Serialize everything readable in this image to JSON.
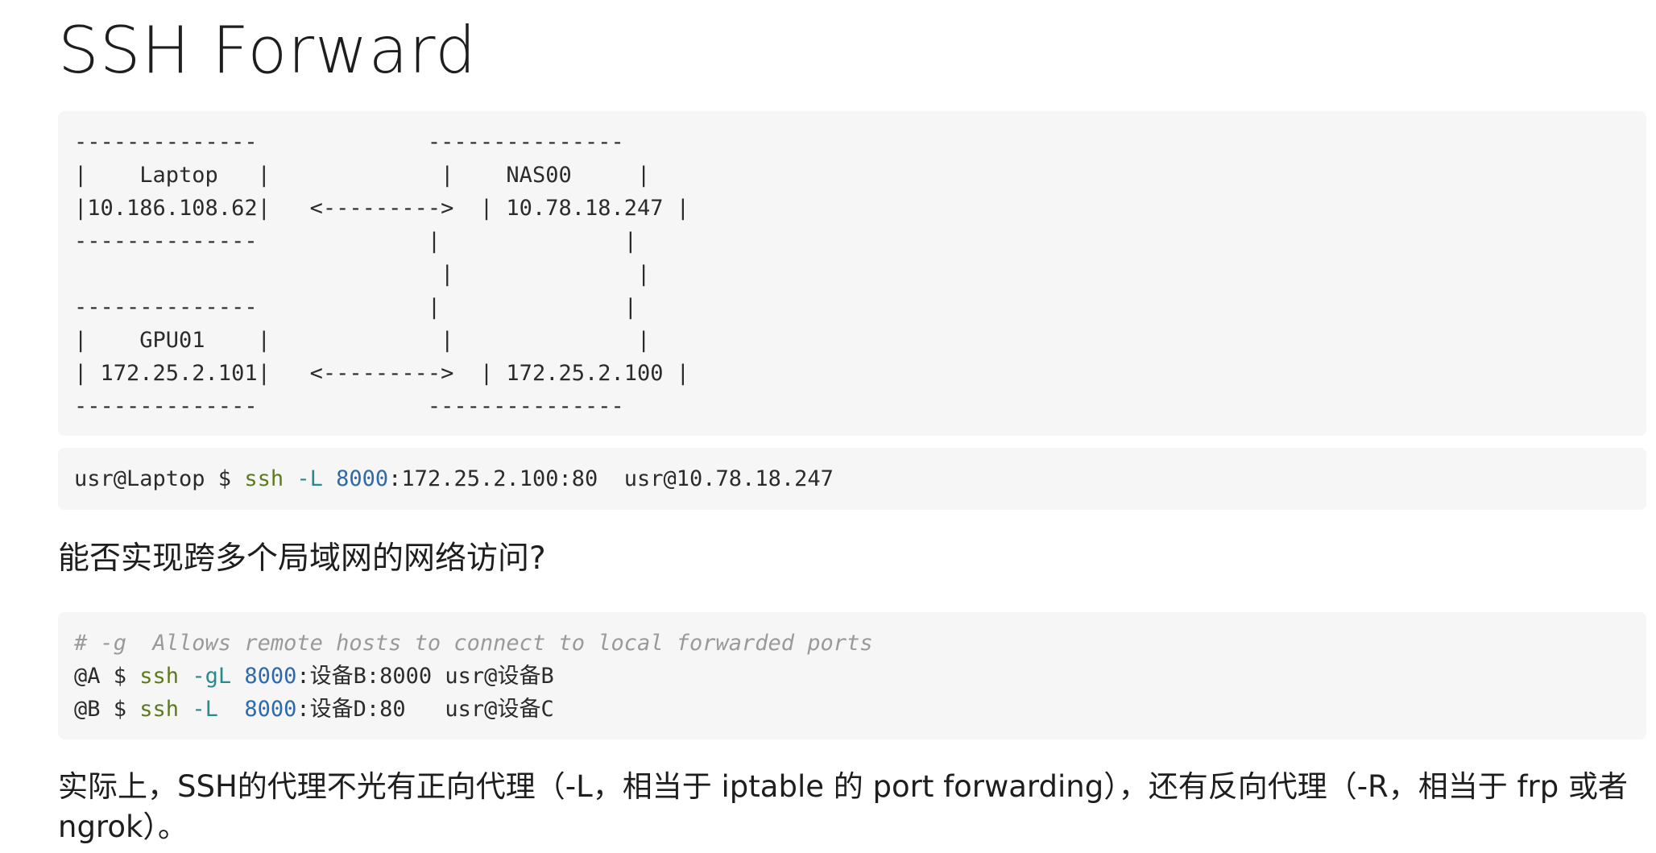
{
  "page_title": "SSH Forward",
  "diagram_lines": [
    "--------------             ---------------",
    "|    Laptop   |             |    NAS00     |",
    "|10.186.108.62|   <--------->  | 10.78.18.247 |",
    "--------------             |              |",
    "                            |              |",
    "--------------             |              |",
    "|    GPU01    |             |              |",
    "| 172.25.2.101|   <--------->  | 172.25.2.100 |",
    "--------------             ---------------"
  ],
  "command_1": {
    "prompt": "usr@Laptop $ ",
    "cmd": "ssh",
    "flag": " -L ",
    "port": "8000",
    "rest": ":172.25.2.100:80  usr@10.78.18.247"
  },
  "heading": "能否实现跨多个局域网的网络访问?",
  "command_2": {
    "comment": "# -g  Allows remote hosts to connect to local forwarded ports",
    "line_a": {
      "prompt": "@A $ ",
      "cmd": "ssh",
      "flag": " -gL ",
      "port": "8000",
      "rest": ":设备B:8000 usr@设备B"
    },
    "line_b": {
      "prompt": "@B $ ",
      "cmd": "ssh",
      "flag": " -L  ",
      "port": "8000",
      "rest": ":设备D:80   usr@设备C"
    }
  },
  "paragraph": "实际上，SSH的代理不光有正向代理（-L，相当于 iptable 的 port forwarding），还有反向代理（-R，相当于 frp 或者 ngrok）。",
  "colors": {
    "code_background": "#f6f6f6",
    "command_color": "#5d7a1e",
    "flag_color": "#2b8a8a",
    "number_color": "#2e6aa8",
    "comment_color": "#9a9a9a"
  }
}
